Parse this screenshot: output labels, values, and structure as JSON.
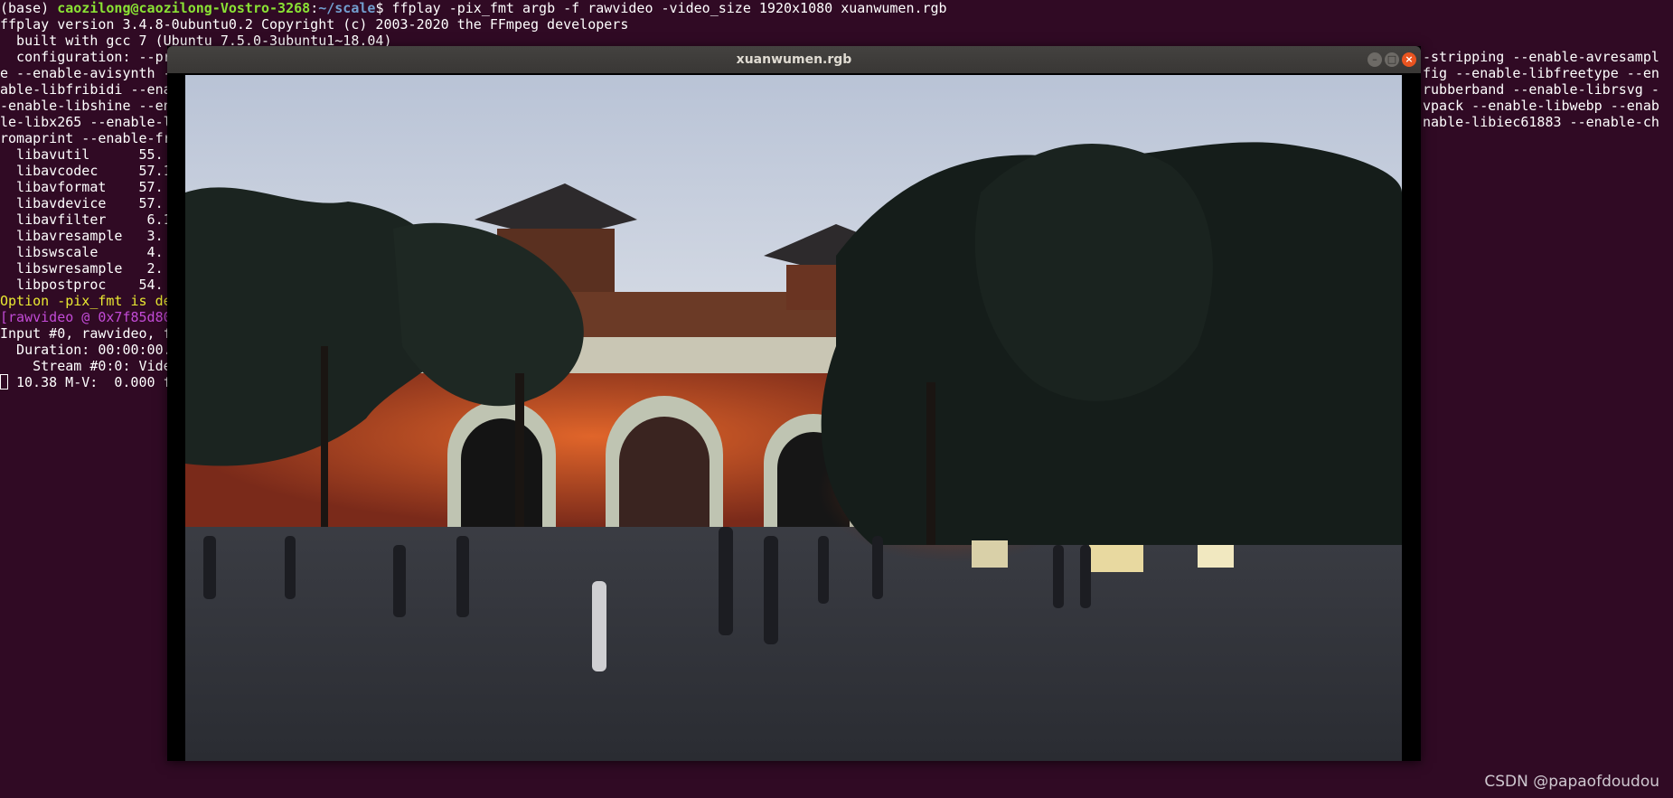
{
  "terminal": {
    "prompt": {
      "env": "(base) ",
      "user_host": "caozilong@caozilong-Vostro-3268",
      "sep": ":",
      "path": "~/scale",
      "symbol": "$",
      "command": " ffplay -pix_fmt argb -f rawvideo -video_size 1920x1080 xuanwumen.rgb"
    },
    "lines_left": [
      "ffplay version 3.4.8-0ubuntu0.2 Copyright (c) 2003-2020 the FFmpeg developers",
      "  built with gcc 7 (Ubuntu 7.5.0-3ubuntu1~18.04)",
      "  configuration: --pr",
      "e --enable-avisynth -",
      "able-libfribidi --ena",
      "-enable-libshine --en",
      "le-libx265 --enable-l",
      "romaprint --enable-fr",
      "  libavutil      55.",
      "  libavcodec     57.1",
      "  libavformat    57.",
      "  libavdevice    57.",
      "  libavfilter     6.1",
      "  libavresample   3.",
      "  libswscale      4.",
      "  libswresample   2.",
      "  libpostproc    54."
    ],
    "warning_line": "Option -pix_fmt is de",
    "rawvideo_line": "[rawvideo @ 0x7f85d80",
    "lines_after": [
      "Input #0, rawvideo, f",
      "  Duration: 00:00:00.",
      "    Stream #0:0: Vide"
    ],
    "status_line": "10.38 M-V:  0.000 f",
    "lines_right": [
      "-stripping --enable-avresampl",
      "fig --enable-libfreetype --en",
      "rubberband --enable-librsvg -",
      "vpack --enable-libwebp --enab",
      "nable-libiec61883 --enable-ch"
    ]
  },
  "window": {
    "title": "xuanwumen.rgb",
    "minimize_label": "–",
    "maximize_label": "□",
    "close_label": "×"
  },
  "watermark": "CSDN @papaofdoudou",
  "colors": {
    "terminal_bg": "#300a24",
    "prompt_green": "#8ae234",
    "prompt_blue": "#729fcf",
    "warning_yellow": "#e9e932",
    "rawvideo_magenta": "#c24bd6",
    "close_orange": "#e95420"
  }
}
